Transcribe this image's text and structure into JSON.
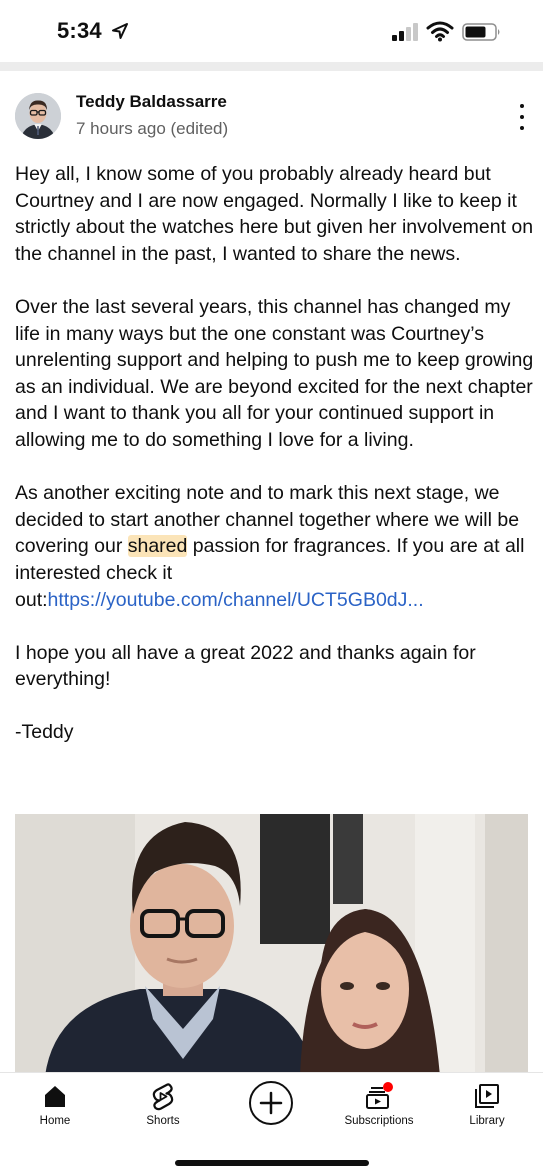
{
  "status_bar": {
    "time": "5:34",
    "location_icon": "location-arrow-icon",
    "signal_icon": "cellular-signal-icon",
    "wifi_icon": "wifi-icon",
    "battery_icon": "battery-icon"
  },
  "post": {
    "author": "Teddy Baldassarre",
    "timestamp": "7 hours ago (edited)",
    "paragraphs": {
      "p1": "Hey all, I know some of you probably already heard but Courtney and I are now engaged. Normally I like to keep it strictly about the watches here but given her involvement on the channel in the past, I wanted to share the news.",
      "p2": "Over the last several years, this channel has changed my life in many ways but the one constant was Courtney’s unrelenting support and helping to push me to keep growing as an individual. We are beyond excited for the next chapter and I want to thank you all for your continued support in allowing me to do something I love for a living.",
      "p3_before": "As another exciting note and to mark this next stage, we decided to start another channel together where we will be covering our ",
      "p3_highlight": "shared",
      "p3_after": " passion for fragrances. If you are at all interested check it out:",
      "p3_link": "https://youtube.com/channel/UCT5GB0dJ...",
      "p4": "I hope you all have a great 2022 and thanks again for everything!",
      "p5": "-Teddy"
    }
  },
  "bottom_nav": {
    "home": "Home",
    "shorts": "Shorts",
    "create_icon": "plus-circle-icon",
    "subscriptions": "Subscriptions",
    "library": "Library"
  },
  "colors": {
    "link": "#2b63c6",
    "highlight": "#fbe4b8",
    "notification_dot": "#ff0000",
    "secondary_text": "#606060"
  }
}
